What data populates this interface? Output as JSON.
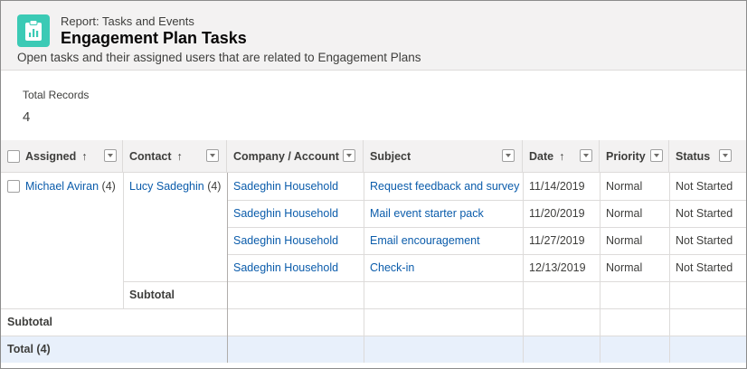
{
  "header": {
    "report_type": "Report: Tasks and Events",
    "title": "Engagement Plan Tasks",
    "description": "Open tasks and their assigned users that are related to Engagement Plans"
  },
  "summary": {
    "total_label": "Total Records",
    "total_value": "4"
  },
  "columns": [
    {
      "label": "Assigned",
      "sort": "↑"
    },
    {
      "label": "Contact",
      "sort": "↑"
    },
    {
      "label": "Company / Account",
      "sort": ""
    },
    {
      "label": "Subject",
      "sort": ""
    },
    {
      "label": "Date",
      "sort": "↑"
    },
    {
      "label": "Priority",
      "sort": ""
    },
    {
      "label": "Status",
      "sort": ""
    }
  ],
  "group": {
    "assigned": "Michael Aviran",
    "assigned_count": "(4)",
    "contact": "Lucy Sadeghin",
    "contact_count": "(4)"
  },
  "rows": [
    {
      "account": "Sadeghin Household",
      "subject": "Request feedback and survey",
      "date": "11/14/2019",
      "priority": "Normal",
      "status": "Not Started"
    },
    {
      "account": "Sadeghin Household",
      "subject": "Mail event starter pack",
      "date": "11/20/2019",
      "priority": "Normal",
      "status": "Not Started"
    },
    {
      "account": "Sadeghin Household",
      "subject": "Email encouragement",
      "date": "11/27/2019",
      "priority": "Normal",
      "status": "Not Started"
    },
    {
      "account": "Sadeghin Household",
      "subject": "Check-in",
      "date": "12/13/2019",
      "priority": "Normal",
      "status": "Not Started"
    }
  ],
  "subtotal_label": "Subtotal",
  "total_label": "Total",
  "total_count": "(4)",
  "colors": {
    "accent": "#3bcab5",
    "link": "#0b5cab",
    "total_row": "#e8f0fb"
  }
}
